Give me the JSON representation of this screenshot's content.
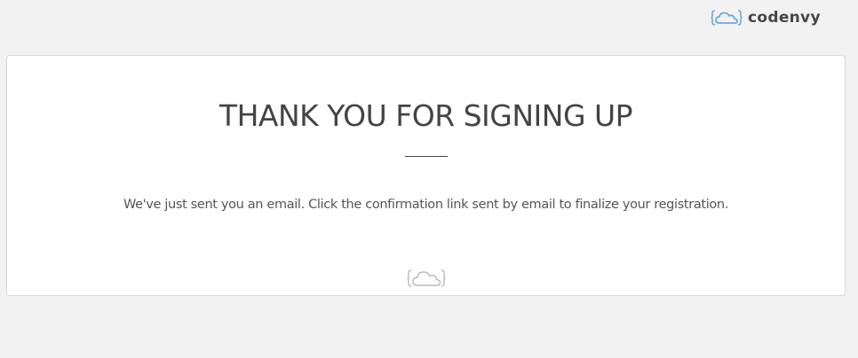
{
  "header": {
    "brand_name": "codenvy",
    "logo_icon": "cloud-braces-icon",
    "logo_color": "#6fa8d8"
  },
  "card": {
    "title": "THANK YOU FOR SIGNING UP",
    "message": "We've just sent you an email. Click the confirmation link sent by email to finalize your registration.",
    "footer_icon": "cloud-braces-icon",
    "footer_icon_color": "#bbbbbb"
  },
  "colors": {
    "background": "#f2f2f2",
    "card_background": "#ffffff",
    "card_border": "#d9d9d9",
    "text": "#444444"
  }
}
